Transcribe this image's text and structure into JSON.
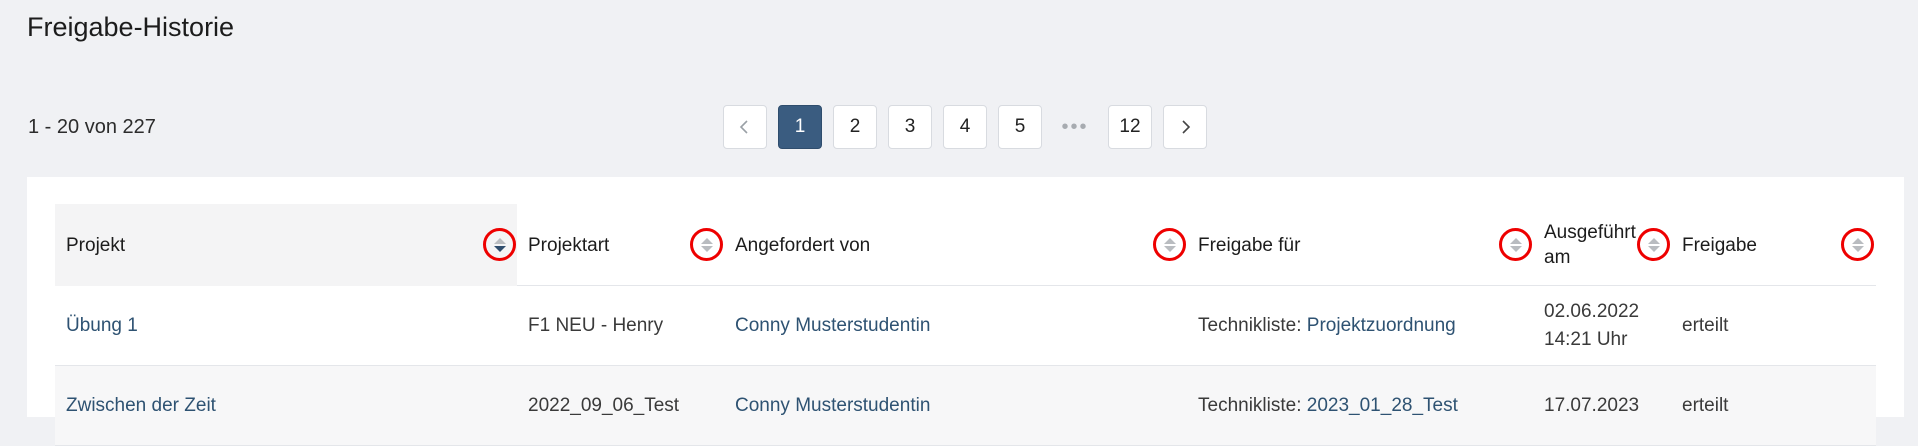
{
  "page": {
    "title": "Freigabe-Historie"
  },
  "pagination": {
    "range_text": "1 - 20 von 227",
    "prev_icon": "chevron-left-icon",
    "next_icon": "chevron-right-icon",
    "pages": [
      "1",
      "2",
      "3",
      "4",
      "5"
    ],
    "ellipsis": "•••",
    "last_page": "12",
    "current_page": "1"
  },
  "table": {
    "columns": {
      "projekt": "Projekt",
      "projektart": "Projektart",
      "angefordert": "Angefordert von",
      "freigabe_fuer": "Freigabe für",
      "ausgefuehrt": "Ausgeführt am",
      "freigabe": "Freigabe"
    },
    "sort_icon": "sort-icon",
    "rows": [
      {
        "projekt": "Übung 1",
        "projektart": "F1 NEU - Henry",
        "angefordert": "Conny Musterstudentin",
        "freigabe_prefix": "Technikliste: ",
        "freigabe_link": "Projektzuordnung",
        "ausgefuehrt_date": "02.06.2022",
        "ausgefuehrt_time": "14:21 Uhr",
        "freigabe": "erteilt"
      },
      {
        "projekt": "Zwischen der Zeit",
        "projektart": "2022_09_06_Test",
        "angefordert": "Conny Musterstudentin",
        "freigabe_prefix": "Technikliste: ",
        "freigabe_link": "2023_01_28_Test",
        "ausgefuehrt_date": "17.07.2023",
        "ausgefuehrt_time": "",
        "freigabe": "erteilt"
      }
    ]
  },
  "colors": {
    "accent": "#3a5c80",
    "link": "#2e5272",
    "highlight": "#ee0000"
  }
}
